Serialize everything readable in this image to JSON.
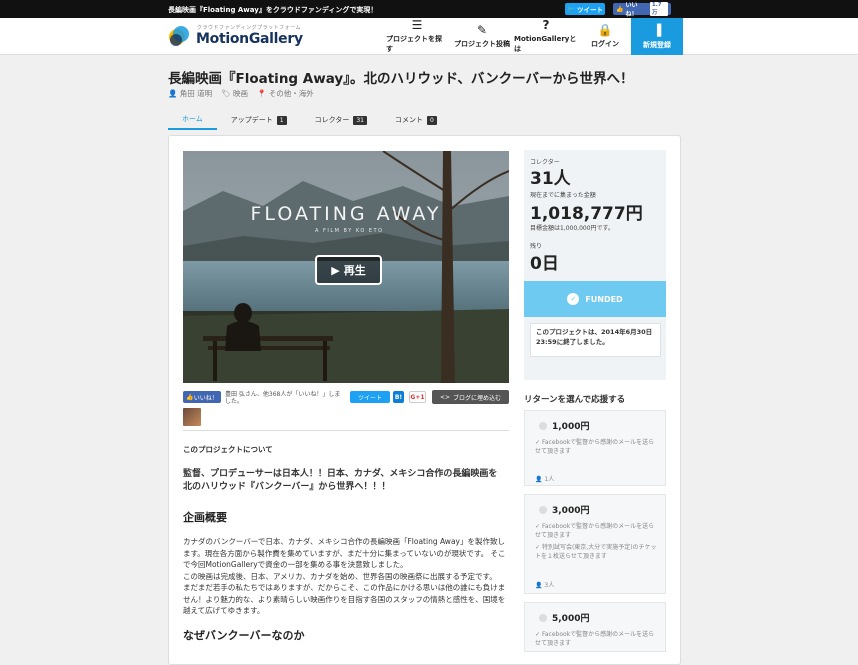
{
  "topbar": {
    "message": "長編映画『Floating Away』をクラウドファンディングで実現！",
    "tweet": "ツイート",
    "fb_like": "いいね！",
    "fb_count": "1.7万"
  },
  "header": {
    "logo_sub": "クラウドファンディングプラットフォーム",
    "logo": "MotionGallery",
    "nav": [
      {
        "label": "プロジェクトを探す",
        "icon": "list-icon"
      },
      {
        "label": "プロジェクト投稿",
        "icon": "pencil-icon"
      },
      {
        "label": "MotionGalleryとは",
        "icon": "question-icon"
      },
      {
        "label": "ログイン",
        "icon": "lock-icon"
      }
    ],
    "signup": "新規登録"
  },
  "project": {
    "title": "長編映画『Floating Away』。北のハリウッド、バンクーバーから世界へ！",
    "owner": "角田 道明",
    "category": "映画",
    "location": "その他・海外"
  },
  "tabs": [
    {
      "label": "ホーム",
      "count": ""
    },
    {
      "label": "アップデート",
      "count": "1"
    },
    {
      "label": "コレクター",
      "count": "31"
    },
    {
      "label": "コメント",
      "count": "0"
    }
  ],
  "video": {
    "title": "FLOATING AWAY",
    "subtitle": "A FILM BY KO ETO",
    "play": "再生"
  },
  "social": {
    "like": "いいね！",
    "like_text": "豊田 弘さん、他368人が「いいね！」しました。",
    "tweet": "ツイート",
    "hatena": "B!",
    "gplus": "G+1",
    "embed": "ブログに埋め込む"
  },
  "content": {
    "about": "このプロジェクトについて",
    "lead1": "監督、プロデューサーは日本人！！日本、カナダ、メキシコ合作の長編映画を",
    "lead2": "北のハリウッド『バンクーバー』から世界へ！！！",
    "h_overview": "企画概要",
    "p1": "カナダのバンクーバーで日本、カナダ、メキシコ合作の長編映画「Floating Away」を製作致します。現在各方面から製作費を集めていますが、まだ十分に集まっていないのが現状です。 そこで今回MotionGalleryで資金の一部を集める事を決意致しました。",
    "p2": "この映画は完成後、日本、アメリカ、カナダを始め、世界各国の映画祭に出展する予定です。",
    "p3": "まだまだ若手の私たちではありますが、だからこそ、この作品にかける思いは他の誰にも負けません！より魅力的な、より素晴らしい映画作りを目指す各国のスタッフの情熱と感性を、国境を越えて広げてゆきます。",
    "h_why": "なぜバンクーバーなのか"
  },
  "stats": {
    "collectors_label": "コレクター",
    "collectors": "31人",
    "amount_label": "現在までに集まった金額",
    "amount": "1,018,777円",
    "goal": "目標金額は1,000,000円です。",
    "remain_label": "残り",
    "remain": "0日",
    "funded": "FUNDED",
    "ended": "このプロジェクトは、2014年6月30日23:59に終了しました。"
  },
  "returns": {
    "title": "リターンを選んで応援する",
    "items": [
      {
        "price": "1,000円",
        "desc": [
          "Facebookで監督から感謝のメールを送らせて頂きます"
        ],
        "count": "1人"
      },
      {
        "price": "3,000円",
        "desc": [
          "Facebookで監督から感謝のメールを送らせて頂きます",
          "特別試写会(東京,大分で実施予定)のチケットを１枚送らせて頂きます"
        ],
        "count": "3人"
      },
      {
        "price": "5,000円",
        "desc": [
          "Facebookで監督から感謝のメールを送らせて頂きます"
        ],
        "count": ""
      }
    ]
  },
  "colors": {
    "accent": "#1a9be0",
    "funded": "#6ecaf0",
    "fb": "#4267b2",
    "twitter": "#1da1f2"
  }
}
